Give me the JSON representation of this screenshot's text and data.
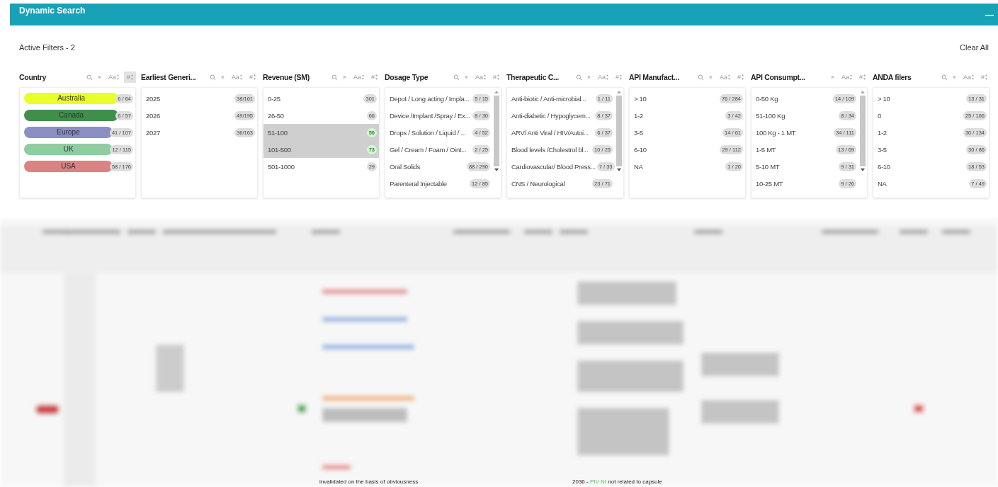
{
  "panel": {
    "title": "Dynamic Search",
    "collapse": "—"
  },
  "active_filters": "Active Filters - 2",
  "clear_all": "Clear All",
  "filters": [
    {
      "title": "Country",
      "search": true,
      "clear": "×",
      "alpha_sort": "Aa",
      "num_sort": "#",
      "num_sort_selected": true,
      "scrollbar": false,
      "items": [
        {
          "label": "Australia",
          "count": "6 / 64",
          "color": "#eaff2a",
          "selected": false
        },
        {
          "label": "Canada",
          "count": "6 / 57",
          "color": "#3f8f4a",
          "selected": false
        },
        {
          "label": "Europe",
          "count": "41 / 107",
          "color": "#8b8fc4",
          "selected": false
        },
        {
          "label": "UK",
          "count": "12 / 115",
          "color": "#8fcc9f",
          "selected": false
        },
        {
          "label": "USA",
          "count": "58 / 176",
          "color": "#d98383",
          "selected": false
        }
      ]
    },
    {
      "title": "Earliest Generi...",
      "search": true,
      "clear": "×",
      "alpha_sort": "Aa",
      "num_sort": "#",
      "num_sort_selected": false,
      "scrollbar": false,
      "items": [
        {
          "label": "2025",
          "count": "38/161",
          "selected": false
        },
        {
          "label": "2026",
          "count": "49/195",
          "selected": false
        },
        {
          "label": "2027",
          "count": "36/163",
          "selected": false
        }
      ]
    },
    {
      "title": "Revenue (SM)",
      "search": true,
      "clear": "×",
      "alpha_sort": "Aa",
      "num_sort": "#",
      "num_sort_selected": false,
      "scrollbar": false,
      "items": [
        {
          "label": "0-25",
          "count": "301",
          "selected": false
        },
        {
          "label": "26-50",
          "count": "66",
          "selected": false
        },
        {
          "label": "51-100",
          "count": "50",
          "selected": true
        },
        {
          "label": "101-500",
          "count": "73",
          "selected": true
        },
        {
          "label": "501-1000",
          "count": "29",
          "selected": false
        }
      ]
    },
    {
      "title": "Dosage Type",
      "search": true,
      "clear": "×",
      "alpha_sort": "Aa",
      "num_sort": "#",
      "num_sort_selected": false,
      "scrollbar": true,
      "items": [
        {
          "label": "Depot / Long acting / Impla...",
          "count": "5 / 15",
          "selected": false
        },
        {
          "label": "Device /Implant /Spray / Ex...",
          "count": "8 / 30",
          "selected": false
        },
        {
          "label": "Drops / Solution / Liquid / ...",
          "count": "4 / 52",
          "selected": false
        },
        {
          "label": "Gel / Cream / Foam / Oint...",
          "count": "2 / 25",
          "selected": false
        },
        {
          "label": "Oral Solids",
          "count": "88 / 290",
          "selected": false
        },
        {
          "label": "Parenteral Injectable",
          "count": "12 / 85",
          "selected": false
        }
      ]
    },
    {
      "title": "Therapeutic C...",
      "search": true,
      "clear": "×",
      "alpha_sort": "Aa",
      "num_sort": "#",
      "num_sort_selected": false,
      "scrollbar": true,
      "items": [
        {
          "label": "Anti-biotic / Anti-microbial...",
          "count": "1 / 11",
          "selected": false
        },
        {
          "label": "Anti-diabetic / Hypoglycem...",
          "count": "8 / 37",
          "selected": false
        },
        {
          "label": "ARV/ Anti Viral / HIV/Autoi...",
          "count": "6 / 37",
          "selected": false
        },
        {
          "label": "Blood levels /Cholestrol bl...",
          "count": "10 / 25",
          "selected": false
        },
        {
          "label": "Cardiovascular/ Blood Press...",
          "count": "7 / 33",
          "selected": false
        },
        {
          "label": "CNS / Neurological",
          "count": "23 / 71",
          "selected": false
        }
      ]
    },
    {
      "title": "API Manufact...",
      "search": true,
      "clear": "×",
      "alpha_sort": "Aa",
      "num_sort": "#",
      "num_sort_selected": false,
      "scrollbar": false,
      "items": [
        {
          "label": "> 10",
          "count": "76 / 284",
          "selected": false
        },
        {
          "label": "1-2",
          "count": "3 / 42",
          "selected": false
        },
        {
          "label": "3-5",
          "count": "14 / 61",
          "selected": false
        },
        {
          "label": "6-10",
          "count": "29 / 112",
          "selected": false
        },
        {
          "label": "NA",
          "count": "1 / 20",
          "selected": false
        }
      ]
    },
    {
      "title": "API Consumpt...",
      "search": false,
      "clear": "×",
      "alpha_sort": "Aa",
      "num_sort": "#",
      "num_sort_selected": false,
      "scrollbar": true,
      "items": [
        {
          "label": "0-50 Kg",
          "count": "14 / 109",
          "selected": false
        },
        {
          "label": "51-100 Kg",
          "count": "8 / 34",
          "selected": false
        },
        {
          "label": "100 Kg - 1 MT",
          "count": "34 / 111",
          "selected": false
        },
        {
          "label": "1-5 MT",
          "count": "13 / 69",
          "selected": false
        },
        {
          "label": "5-10 MT",
          "count": "9 / 31",
          "selected": false
        },
        {
          "label": "10-25 MT",
          "count": "9 / 26",
          "selected": false
        }
      ]
    },
    {
      "title": "ANDA filers",
      "search": true,
      "clear": "×",
      "alpha_sort": "Aa",
      "num_sort": "#",
      "num_sort_selected": false,
      "scrollbar": false,
      "items": [
        {
          "label": "> 10",
          "count": "13 / 31",
          "selected": false
        },
        {
          "label": "0",
          "count": "25 / 166",
          "selected": false
        },
        {
          "label": "1-2",
          "count": "30 / 134",
          "selected": false
        },
        {
          "label": "3-5",
          "count": "30 / 86",
          "selected": false
        },
        {
          "label": "6-10",
          "count": "18 / 53",
          "selected": false
        },
        {
          "label": "NA",
          "count": "7 / 49",
          "selected": false
        }
      ]
    }
  ],
  "table_notes": [
    {
      "text": "invalidated on the basis of obviousness"
    },
    {
      "text": "2036 - ",
      "highlight": "PIV NI",
      "rest": " not related to capsule"
    }
  ]
}
